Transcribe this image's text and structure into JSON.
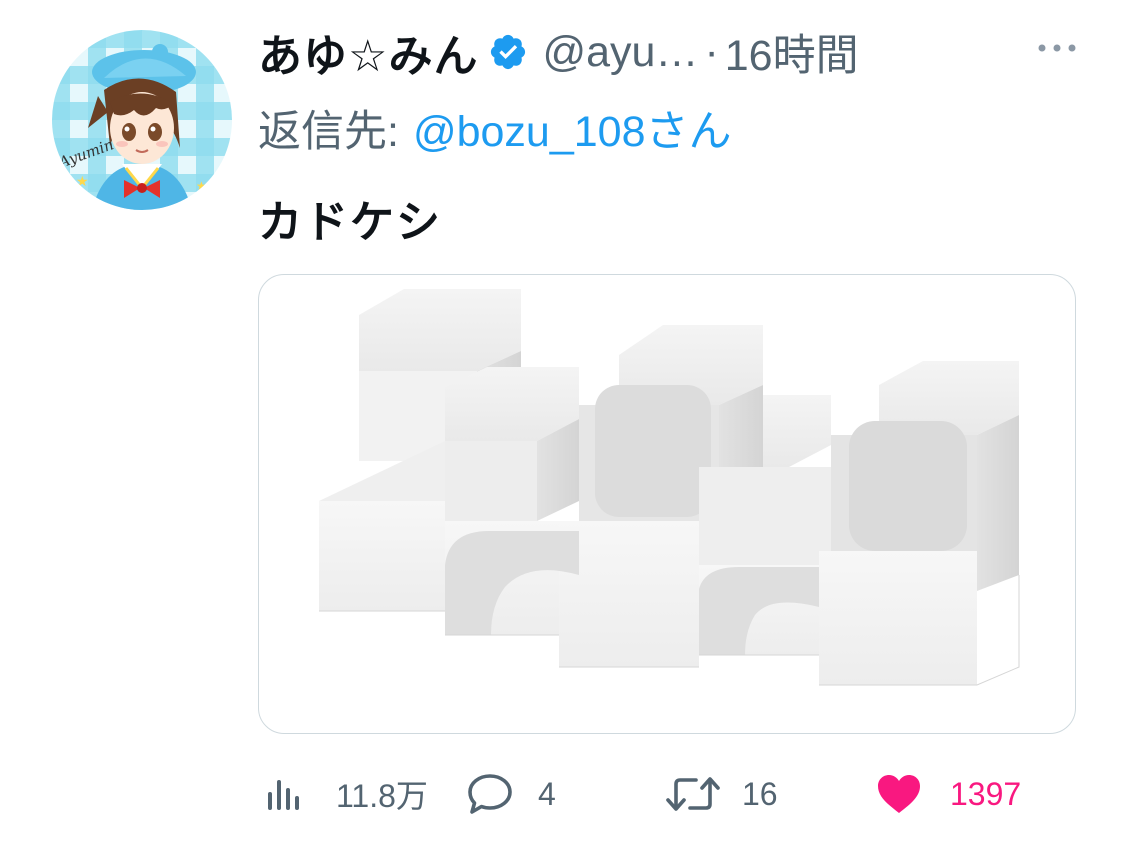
{
  "tweet": {
    "display_name": "あゆ☆みん",
    "handle": "@ayu…",
    "separator": "·",
    "time": "16時間",
    "reply_label": "返信先:",
    "reply_mention": "@bozu_108さん",
    "text": "カドケシ",
    "avatar_signature": "Ayumin"
  },
  "actions": {
    "views": {
      "icon": "views-icon",
      "count": "11.8万"
    },
    "reply": {
      "icon": "reply-icon",
      "count": "4"
    },
    "retweet": {
      "icon": "retweet-icon",
      "count": "16"
    },
    "like": {
      "icon": "heart-icon",
      "count": "1397"
    }
  },
  "colors": {
    "text": "#0f1419",
    "secondary": "#536471",
    "link": "#1d9bf0",
    "like": "#f91880",
    "border": "#cfd9de"
  }
}
